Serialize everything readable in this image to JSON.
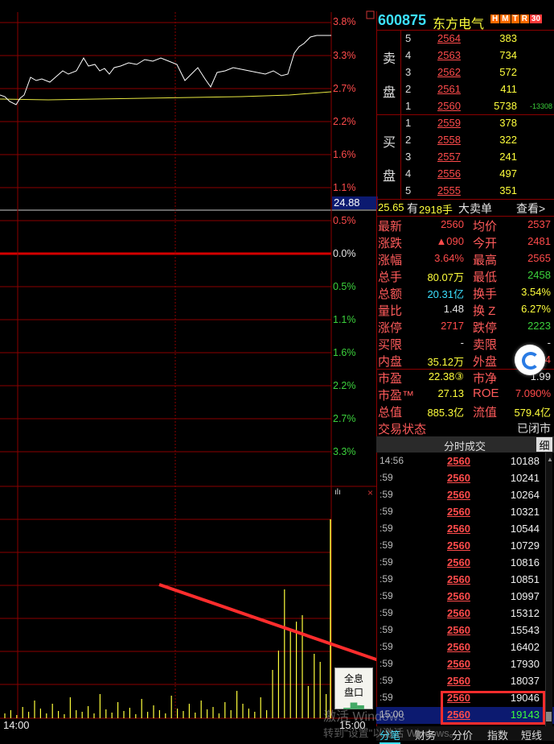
{
  "chart": {
    "pct_labels_top": [
      "3.8%",
      "3.3%",
      "2.7%",
      "2.2%",
      "1.6%",
      "1.1%",
      "0.5%",
      "0.0%",
      "0.5%",
      "1.1%",
      "1.6%",
      "2.2%",
      "2.7%",
      "3.3%"
    ],
    "price_line_value": "24.88",
    "time_start": "14:00",
    "time_end": "15:00",
    "colors": {
      "up": "#ff4b4b",
      "down": "#3cd13c",
      "price_line": "#ffffff",
      "avg_line": "#e8e840",
      "grid": "#8b0000"
    }
  },
  "header": {
    "code": "600875",
    "name": "东方电气",
    "badges": [
      "H",
      "M",
      "T",
      "R",
      "30"
    ]
  },
  "order_book": {
    "sell_label_1": "卖",
    "sell_label_2": "盘",
    "buy_label_1": "买",
    "buy_label_2": "盘",
    "sell": [
      {
        "level": "5",
        "price": "2564",
        "vol": "383"
      },
      {
        "level": "4",
        "price": "2563",
        "vol": "734"
      },
      {
        "level": "3",
        "price": "2562",
        "vol": "572"
      },
      {
        "level": "2",
        "price": "2561",
        "vol": "411"
      },
      {
        "level": "1",
        "price": "2560",
        "vol": "5738",
        "chg": "-13308"
      }
    ],
    "buy": [
      {
        "level": "1",
        "price": "2559",
        "vol": "378"
      },
      {
        "level": "2",
        "price": "2558",
        "vol": "322"
      },
      {
        "level": "3",
        "price": "2557",
        "vol": "241"
      },
      {
        "level": "4",
        "price": "2556",
        "vol": "497"
      },
      {
        "level": "5",
        "price": "2555",
        "vol": "351"
      }
    ]
  },
  "big_order": {
    "price": "25.65",
    "text1": "有",
    "qty": "2918手",
    "text2": "大卖单",
    "link": "查看>"
  },
  "quote": [
    {
      "l1": "最新",
      "v1": "2560",
      "c1": "red",
      "l2": "均价",
      "v2": "2537",
      "c2": "red"
    },
    {
      "l1": "涨跌",
      "v1": "▲090",
      "c1": "red",
      "l2": "今开",
      "v2": "2481",
      "c2": "red"
    },
    {
      "l1": "涨幅",
      "v1": "3.64%",
      "c1": "red",
      "l2": "最高",
      "v2": "2565",
      "c2": "red"
    },
    {
      "l1": "总手",
      "v1": "80.07万",
      "c1": "yellow",
      "l2": "最低",
      "v2": "2458",
      "c2": "green"
    },
    {
      "l1": "总额",
      "v1": "20.31亿",
      "c1": "cyan",
      "l2": "换手",
      "v2": "3.54%",
      "c2": "yellow"
    },
    {
      "l1": "量比",
      "v1": "1.48",
      "c1": "white",
      "l2": "换 Z",
      "v2": "6.27%",
      "c2": "yellow"
    },
    {
      "l1": "涨停",
      "v1": "2717",
      "c1": "red",
      "l2": "跌停",
      "v2": "2223",
      "c2": "green"
    },
    {
      "l1": "买限",
      "v1": "-",
      "c1": "white",
      "l2": "卖限",
      "v2": "-",
      "c2": "white"
    },
    {
      "l1": "内盘",
      "v1": "35.12万",
      "c1": "yellow",
      "l2": "外盘",
      "v2": "4",
      "c2": "red"
    }
  ],
  "valuation": [
    {
      "l1": "市盈",
      "v1": "22.38③",
      "c1": "yellow",
      "l2": "市净",
      "v2": "1.99",
      "c2": "white"
    },
    {
      "l1": "市盈™",
      "v1": "27.13",
      "c1": "yellow",
      "l2": "ROE",
      "v2": "7.090%",
      "c2": "red"
    },
    {
      "l1": "总值",
      "v1": "885.3亿",
      "c1": "yellow",
      "l2": "流值",
      "v2": "579.4亿",
      "c2": "yellow"
    }
  ],
  "status": {
    "label": "交易状态",
    "value": "已闭市"
  },
  "ticks_header": {
    "title": "分时成交",
    "btn": "细"
  },
  "ticks": [
    {
      "t": "14:56",
      "p": "2560",
      "v": "10188"
    },
    {
      "t": ":59",
      "p": "2560",
      "v": "10241"
    },
    {
      "t": ":59",
      "p": "2560",
      "v": "10264"
    },
    {
      "t": ":59",
      "p": "2560",
      "v": "10321"
    },
    {
      "t": ":59",
      "p": "2560",
      "v": "10544"
    },
    {
      "t": ":59",
      "p": "2560",
      "v": "10729"
    },
    {
      "t": ":59",
      "p": "2560",
      "v": "10816"
    },
    {
      "t": ":59",
      "p": "2560",
      "v": "10851"
    },
    {
      "t": ":59",
      "p": "2560",
      "v": "10997"
    },
    {
      "t": ":59",
      "p": "2560",
      "v": "15312"
    },
    {
      "t": ":59",
      "p": "2560",
      "v": "15543"
    },
    {
      "t": ":59",
      "p": "2560",
      "v": "16402"
    },
    {
      "t": ":59",
      "p": "2560",
      "v": "17930"
    },
    {
      "t": ":59",
      "p": "2560",
      "v": "18037"
    },
    {
      "t": ":59",
      "p": "2560",
      "v": "19046"
    },
    {
      "t": "15:00",
      "p": "2560",
      "v": "19143"
    }
  ],
  "tabs": [
    "分笔",
    "财务",
    "分价",
    "指数",
    "短线"
  ],
  "info_button": {
    "line1": "全息",
    "line2": "盘口"
  },
  "watermark": {
    "line1": "激活 Windows",
    "line2": "转到\"设置\"以激活 Windows。"
  }
}
